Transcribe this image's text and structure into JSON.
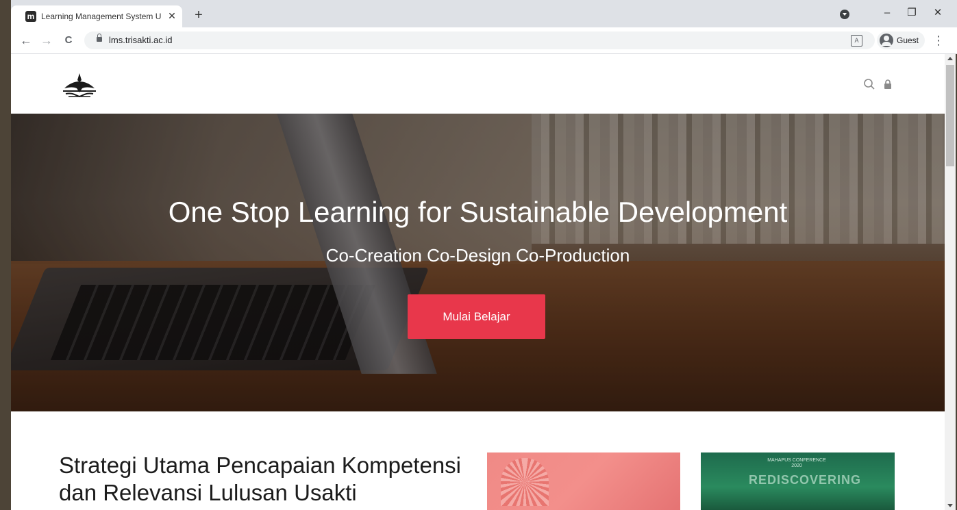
{
  "browser": {
    "tab_title": "Learning Management System U",
    "tab_favicon_letter": "m",
    "new_tab": "+",
    "url": "lms.trisakti.ac.id",
    "profile_label": "Guest",
    "window_controls": {
      "minimize": "–",
      "restore": "❐",
      "close": "✕"
    },
    "nav": {
      "back": "←",
      "forward": "→",
      "reload": "C"
    }
  },
  "header": {
    "logo_icon": "trisakti-logo",
    "search_icon": "search-icon",
    "login_icon": "lock-icon"
  },
  "hero": {
    "title": "One Stop Learning for Sustainable Development",
    "subtitle": "Co-Creation Co-Design Co-Production",
    "cta_label": "Mulai Belajar",
    "cta_color": "#e8374b"
  },
  "section": {
    "title": "Strategi Utama Pencapaian Kompetensi dan Relevansi Lulusan Usakti",
    "card2_small_text": "MAHAPUS CONFERENCE 2020",
    "card2_big_text": "REDISCOVERING"
  }
}
